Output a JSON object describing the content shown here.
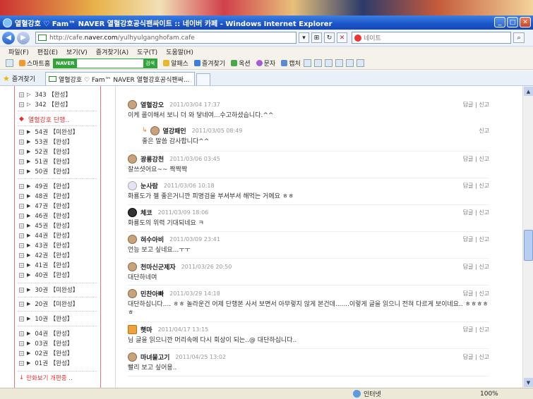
{
  "window": {
    "title": "열혈강호 ♡ Fam™ NAVER 열혈강호공식팬싸이트 :: 네이버 카페 - Windows Internet Explorer"
  },
  "address": {
    "url_prefix": "http://cafe.",
    "url_domain": "naver.com",
    "url_suffix": "/yulhyulganghofam.cafe"
  },
  "search": {
    "placeholder": "네이트"
  },
  "menu": [
    "파일(F)",
    "편집(E)",
    "보기(V)",
    "즐겨찾기(A)",
    "도구(T)",
    "도움말(H)"
  ],
  "toolbar": {
    "smart_home": "스마트홈",
    "naver_label": "NAVER",
    "search_btn": "검색",
    "items": [
      "알패스",
      "즐겨찾기",
      "옥션",
      "문자",
      "캡처"
    ]
  },
  "favorites_label": "즐겨찾기",
  "tab_title": "열혈강호 ♡ Fam™ NAVER 열혈강호공식팬싸...",
  "sidebar": {
    "top": [
      "343 【완성】",
      "342 【완성】"
    ],
    "section_title": "열혈강호 단행..",
    "items": [
      "54권 【미완성】",
      "53권 【완성】",
      "52권 【완성】",
      "51권 【완성】",
      "50권 【완성】",
      "49권 【완성】",
      "48권 【완성】",
      "47권 【완성】",
      "46권 【완성】",
      "45권 【완성】",
      "44권 【완성】",
      "43권 【완성】",
      "42권 【완성】",
      "41권 【완성】",
      "40권 【완성】",
      "30권 【미완성】",
      "20권 【미완성】",
      "10권 【완성】",
      "04권 【완성】",
      "03권 【완성】",
      "02권 【완성】",
      "01권 【완성】"
    ],
    "bottom": "만화보기 개편중 .."
  },
  "comments": [
    {
      "nick": "열혈강오",
      "date": "2011/03/04 17:37",
      "acts": "답글 | 신고",
      "text": "이케 콜이해서 보니 더 와 닿네여...수고하셨습니다.^^"
    },
    {
      "nick": "열강패인",
      "date": "2011/03/05 08:49",
      "acts": "신고",
      "text": "좋은 말씀 감사합니다^^",
      "reply": true
    },
    {
      "nick": "광룡강천",
      "date": "2011/03/06 03:45",
      "acts": "답글 | 신고",
      "text": "잘쓰셧어요~~ 짝짝짝"
    },
    {
      "nick": "눈사람",
      "date": "2011/03/06 10:18",
      "acts": "답글 | 신고",
      "text": "화룡도가 젤 좋은거니깐 피명검을 부셔부셔 해먹는 거에요 ㅎㅎ"
    },
    {
      "nick": "체코",
      "date": "2011/03/09 18:06",
      "acts": "답글 | 신고",
      "text": "화룡도의 위력 기대되네요 ㅋ"
    },
    {
      "nick": "혀수아비",
      "date": "2011/03/09 23:41",
      "acts": "답글 | 신고",
      "text": "언능 보고 싶네요...ㅜㅜ"
    },
    {
      "nick": "천마신군제자",
      "date": "2011/03/26 20:50",
      "acts": "답글 | 신고",
      "text": "대단하네여"
    },
    {
      "nick": "민찬아빠",
      "date": "2011/03/29 14:18",
      "acts": "답글 | 신고",
      "text": "대단하십니다.... ㅎㅎ 놀라운건 어제 단행본 사서 보면서 아무렇지 않게 본건데.......이렇게 글을 읽으니 전혀 다르게 보이네요.. ㅎㅎㅎㅎㅎ"
    },
    {
      "nick": "햇마",
      "date": "2011/04/17 13:15",
      "acts": "답글 | 신고",
      "text": "님 글을 읽으니깐 머리속에 다시 회상이 되는..@ 대단하십니다.."
    },
    {
      "nick": "마녀물고기",
      "date": "2011/04/25 13:02",
      "acts": "답글 | 신고",
      "text": "빨리 보고 싶어용.."
    }
  ],
  "status": {
    "zone": "인터넷",
    "zoom": "100%"
  }
}
